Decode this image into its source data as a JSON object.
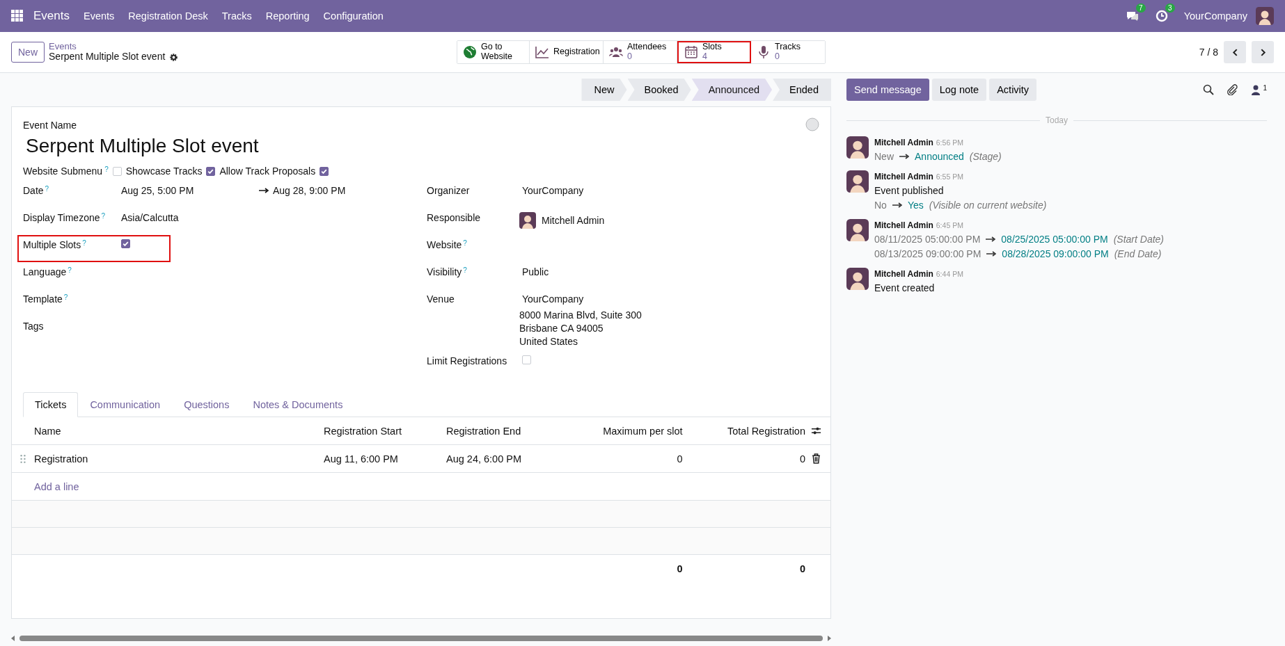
{
  "navbar": {
    "app": "Events",
    "menu": [
      "Events",
      "Registration Desk",
      "Tracks",
      "Reporting",
      "Configuration"
    ],
    "messages_badge": "7",
    "activities_badge": "3",
    "company": "YourCompany"
  },
  "control_panel": {
    "new_button": "New",
    "breadcrumb": "Events",
    "record_title": "Serpent Multiple Slot event",
    "pager": "7 / 8",
    "smart_buttons": [
      {
        "kind": "website",
        "label": "Go to Website",
        "highlighted": false
      },
      {
        "kind": "chart",
        "label": "Registration",
        "highlighted": false
      },
      {
        "kind": "people",
        "label": "Attendees",
        "value": "0",
        "highlighted": false
      },
      {
        "kind": "calendar",
        "label": "Slots",
        "value": "4",
        "highlighted": true
      },
      {
        "kind": "mic",
        "label": "Tracks",
        "value": "0",
        "highlighted": false
      }
    ]
  },
  "stages": [
    {
      "label": "New",
      "selected": false
    },
    {
      "label": "Booked",
      "selected": false
    },
    {
      "label": "Announced",
      "selected": true
    },
    {
      "label": "Ended",
      "selected": false
    }
  ],
  "form": {
    "event_name_label": "Event Name",
    "event_name": "Serpent Multiple Slot event",
    "website_submenu": [
      {
        "label": "Website Submenu",
        "help": "?",
        "checked": false
      },
      {
        "label": "Showcase Tracks",
        "checked": true
      },
      {
        "label": "Allow Track Proposals",
        "checked": true
      }
    ],
    "left_fields": [
      {
        "kind": "daterange",
        "label": "Date",
        "help": "?",
        "start": "Aug 25, 5:00 PM",
        "end": "Aug 28, 9:00 PM"
      },
      {
        "kind": "text",
        "label": "Display Timezone",
        "help": "?",
        "value": "Asia/Calcutta"
      },
      {
        "kind": "checkbox",
        "label": "Multiple Slots",
        "help": "?",
        "checked": true,
        "highlighted": true
      },
      {
        "kind": "empty",
        "label": "Language",
        "help": "?"
      },
      {
        "kind": "empty",
        "label": "Template",
        "help": "?"
      },
      {
        "kind": "empty",
        "label": "Tags"
      }
    ],
    "right_fields": [
      {
        "kind": "text",
        "label": "Organizer",
        "value": "YourCompany"
      },
      {
        "kind": "user",
        "label": "Responsible",
        "value": "Mitchell Admin"
      },
      {
        "kind": "empty",
        "label": "Website",
        "help": "?"
      },
      {
        "kind": "text",
        "label": "Visibility",
        "help": "?",
        "value": "Public"
      },
      {
        "kind": "address",
        "label": "Venue",
        "value": "YourCompany",
        "lines": [
          "8000 Marina Blvd, Suite 300",
          "Brisbane CA 94005",
          "United States"
        ]
      },
      {
        "kind": "checkbox",
        "label": "Limit Registrations",
        "checked": false
      }
    ]
  },
  "tabs": [
    {
      "label": "Tickets",
      "selected": true
    },
    {
      "label": "Communication",
      "selected": false
    },
    {
      "label": "Questions",
      "selected": false
    },
    {
      "label": "Notes & Documents",
      "selected": false
    }
  ],
  "table": {
    "columns": [
      "Name",
      "Registration Start",
      "Registration End",
      "Maximum per slot",
      "Total Registration"
    ],
    "rows": [
      [
        "Registration",
        "Aug 11, 6:00 PM",
        "Aug 24, 6:00 PM",
        "0",
        "0"
      ]
    ],
    "add_line": "Add a line",
    "totals": [
      "0",
      "0"
    ]
  },
  "chatter": {
    "buttons": [
      {
        "label": "Send message",
        "kind": "primary"
      },
      {
        "label": "Log note",
        "kind": "secondary"
      },
      {
        "label": "Activity",
        "kind": "secondary"
      }
    ],
    "followers_count": "1",
    "separator": "Today",
    "messages": [
      {
        "author": "Mitchell Admin",
        "time": "6:56 PM",
        "changes": [
          {
            "old": "New",
            "new": "Announced",
            "field": "(Stage)"
          }
        ]
      },
      {
        "author": "Mitchell Admin",
        "time": "6:55 PM",
        "body": "Event published",
        "changes": [
          {
            "old": "No",
            "new": "Yes",
            "field": "(Visible on current website)"
          }
        ]
      },
      {
        "author": "Mitchell Admin",
        "time": "6:45 PM",
        "changes": [
          {
            "old": "08/11/2025 05:00:00 PM",
            "new": "08/25/2025 05:00:00 PM",
            "field": "(Start Date)"
          },
          {
            "old": "08/13/2025 09:00:00 PM",
            "new": "08/28/2025 09:00:00 PM",
            "field": "(End Date)"
          }
        ]
      },
      {
        "author": "Mitchell Admin",
        "time": "6:44 PM",
        "body": "Event created"
      }
    ]
  }
}
